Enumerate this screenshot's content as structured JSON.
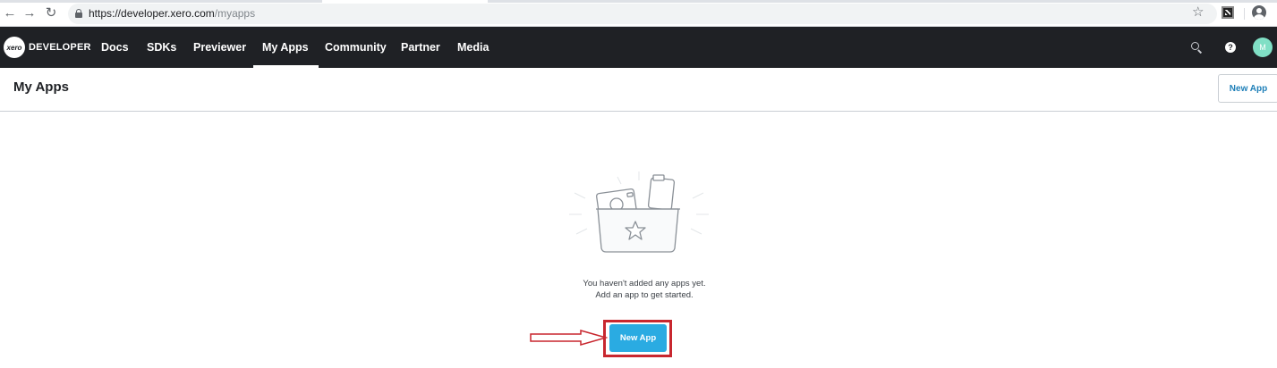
{
  "browser": {
    "url_host": "https://developer.xero.com",
    "url_path": "/myapps"
  },
  "topnav": {
    "logo_mark": "xero",
    "logo_text": "DEVELOPER",
    "items": [
      {
        "label": "Docs",
        "active": false
      },
      {
        "label": "SDKs",
        "active": false
      },
      {
        "label": "Previewer",
        "active": false
      },
      {
        "label": "My Apps",
        "active": true
      },
      {
        "label": "Community",
        "active": false
      },
      {
        "label": "Partner",
        "active": false
      },
      {
        "label": "Media",
        "active": false
      }
    ],
    "help_glyph": "?",
    "avatar_initial": "M"
  },
  "page": {
    "title": "My Apps",
    "header_button": "New App"
  },
  "empty_state": {
    "line1": "You haven't added any apps yet.",
    "line2": "Add an app to get started.",
    "button": "New App"
  },
  "colors": {
    "nav_bg": "#1f2125",
    "accent": "#2aabe2",
    "highlight": "#c8272f",
    "avatar": "#80dfc5"
  }
}
